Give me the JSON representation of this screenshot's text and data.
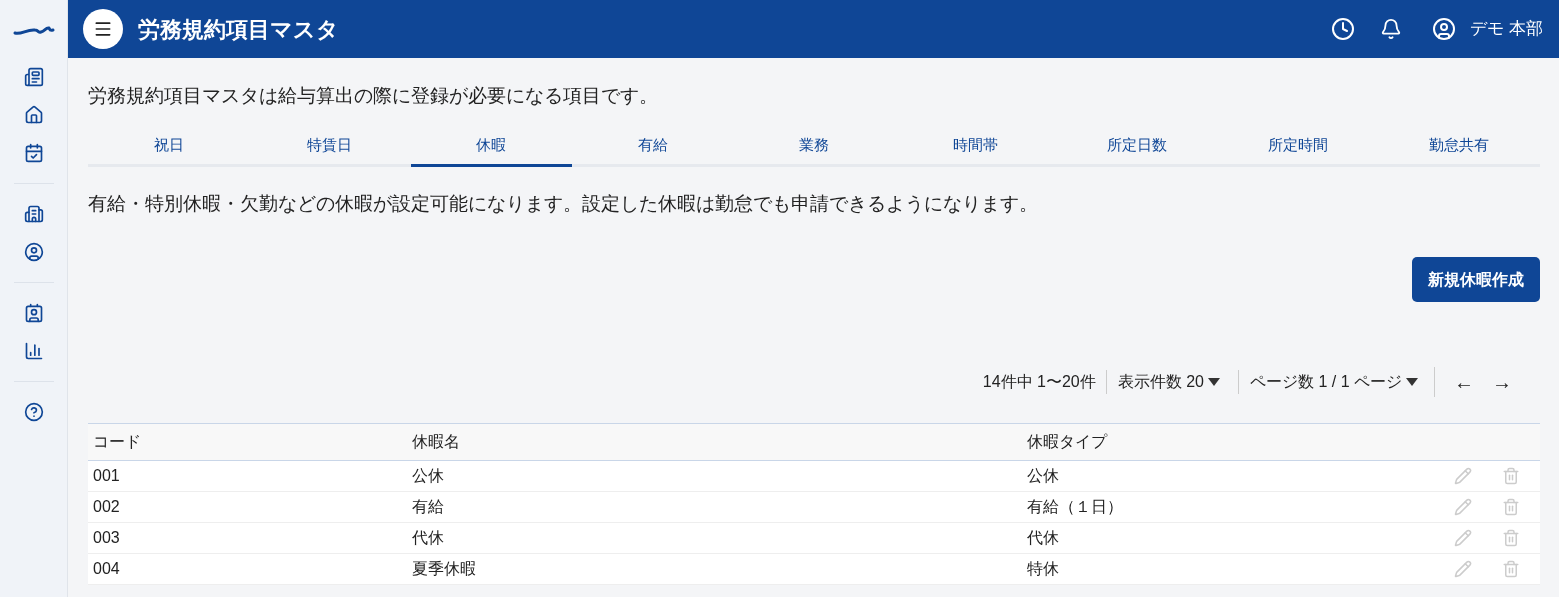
{
  "header": {
    "title": "労務規約項目マスタ",
    "user": "デモ 本部"
  },
  "description": "労務規約項目マスタは給与算出の際に登録が必要になる項目です。",
  "tabs": [
    {
      "label": "祝日",
      "selected": false
    },
    {
      "label": "特賃日",
      "selected": false
    },
    {
      "label": "休暇",
      "selected": true
    },
    {
      "label": "有給",
      "selected": false
    },
    {
      "label": "業務",
      "selected": false
    },
    {
      "label": "時間帯",
      "selected": false
    },
    {
      "label": "所定日数",
      "selected": false
    },
    {
      "label": "所定時間",
      "selected": false
    },
    {
      "label": "勤怠共有",
      "selected": false
    }
  ],
  "tab_description": "有給・特別休暇・欠勤などの休暇が設定可能になります。設定した休暇は勤怠でも申請できるようになります。",
  "create_button": "新規休暇作成",
  "pagination": {
    "count": "14件中 1〜20件",
    "per_page": "表示件数 20",
    "page": "ページ数 1 / 1 ページ",
    "prev": "←",
    "next": "→"
  },
  "table": {
    "columns": [
      "コード",
      "休暇名",
      "休暇タイプ"
    ],
    "rows": [
      {
        "code": "001",
        "name": "公休",
        "type": "公休"
      },
      {
        "code": "002",
        "name": "有給",
        "type": "有給（１日）"
      },
      {
        "code": "003",
        "name": "代休",
        "type": "代休"
      },
      {
        "code": "004",
        "name": "夏季休暇",
        "type": "特休"
      }
    ]
  }
}
